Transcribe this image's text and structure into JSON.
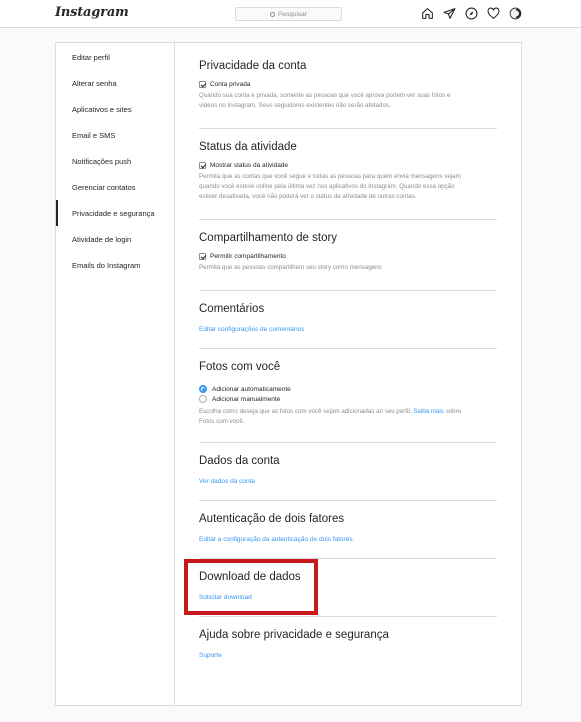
{
  "header": {
    "logo": "Instagram",
    "search_placeholder": "Pesquisar",
    "icons": [
      "home-icon",
      "direct-icon",
      "explore-icon",
      "heart-icon",
      "profile-avatar"
    ]
  },
  "sidebar": {
    "items": [
      {
        "label": "Editar perfil"
      },
      {
        "label": "Alterar senha"
      },
      {
        "label": "Aplicativos e sites"
      },
      {
        "label": "Email e SMS"
      },
      {
        "label": "Notificações push"
      },
      {
        "label": "Gerenciar contatos"
      },
      {
        "label": "Privacidade e segurança",
        "active": true
      },
      {
        "label": "Atividade de login"
      },
      {
        "label": "Emails do Instagram"
      }
    ]
  },
  "sections": {
    "privacy": {
      "title": "Privacidade da conta",
      "checkbox_label": "Conta privada",
      "help_line1": "Quando sua conta é privada, somente as pessoas que você aprova podem ver suas fotos e",
      "help_line2": "vídeos no Instagram. Seus seguidores existentes não serão afetados."
    },
    "activity": {
      "title": "Status da atividade",
      "checkbox_label": "Mostrar status da atividade",
      "help_line1": "Permita que as contas que você segue e todas as pessoas para quem envia mensagens vejam",
      "help_line2": "quando você esteve online pela última vez nos aplicativos do Instagram. Quando essa opção",
      "help_line3": "estiver desativada, você não poderá ver o status de atividade de outras contas."
    },
    "story": {
      "title": "Compartilhamento de story",
      "checkbox_label": "Permitir compartilhamento",
      "help": "Permita que as pessoas compartilhem seu story como mensagens"
    },
    "comments": {
      "title": "Comentários",
      "link": "Editar configurações de comentários"
    },
    "photos": {
      "title": "Fotos com você",
      "radio_auto": "Adicionar automaticamente",
      "radio_manual": "Adicionar manualmente",
      "help_line1": "Escolha como deseja que as fotos com você sejam adicionadas ao seu perfil.",
      "help_link": "Saiba mais",
      "help_after": "sobre",
      "help_line2": "Fotos com você."
    },
    "account_data": {
      "title": "Dados da conta",
      "link": "Ver dados da conta"
    },
    "two_factor": {
      "title": "Autenticação de dois fatores",
      "link": "Editar a configuração da autenticação de dois fatores"
    },
    "download": {
      "title": "Download de dados",
      "link": "Solicitar download"
    },
    "help": {
      "title": "Ajuda sobre privacidade e segurança",
      "link": "Suporte"
    }
  },
  "colors": {
    "link": "#3897f0",
    "highlight_box": "#c8191c",
    "border": "#dbdbdb"
  }
}
